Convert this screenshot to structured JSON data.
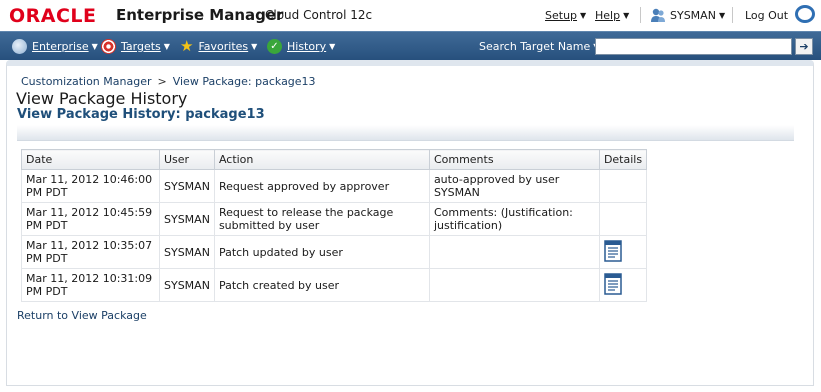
{
  "brand": {
    "logo": "ORACLE",
    "product": "Enterprise Manager",
    "edition": "Cloud Control 12c"
  },
  "topmenu": {
    "setup": "Setup",
    "help": "Help",
    "user": "SYSMAN",
    "logout": "Log Out"
  },
  "nav": {
    "enterprise": "Enterprise",
    "targets": "Targets",
    "favorites": "Favorites",
    "history": "History",
    "search_label": "Search Target Name"
  },
  "breadcrumb": {
    "item1": "Customization Manager",
    "separator": ">",
    "item2": "View Package: package13"
  },
  "page": {
    "title": "View Package History",
    "subtitle": "View Package History: package13",
    "return_link": "Return to View Package"
  },
  "table": {
    "headers": {
      "date": "Date",
      "user": "User",
      "action": "Action",
      "comments": "Comments",
      "details": "Details"
    },
    "rows": [
      {
        "date": "Mar 11, 2012 10:46:00 PM PDT",
        "user": "SYSMAN",
        "action": "Request approved by approver",
        "comments": "auto-approved by user SYSMAN",
        "details_icon": false
      },
      {
        "date": "Mar 11, 2012 10:45:59 PM PDT",
        "user": "SYSMAN",
        "action": "Request to release the package submitted by user",
        "comments": "Comments: (Justification: justification)",
        "details_icon": false
      },
      {
        "date": "Mar 11, 2012 10:35:07 PM PDT",
        "user": "SYSMAN",
        "action": "Patch updated by user",
        "comments": "",
        "details_icon": true
      },
      {
        "date": "Mar 11, 2012 10:31:09 PM PDT",
        "user": "SYSMAN",
        "action": "Patch created by user",
        "comments": "",
        "details_icon": true
      }
    ]
  },
  "colors": {
    "oracle_red": "#e0001b",
    "nav_blue": "#2d5682",
    "link_blue": "#1b3f66",
    "heading_blue": "#1f4f7a"
  }
}
